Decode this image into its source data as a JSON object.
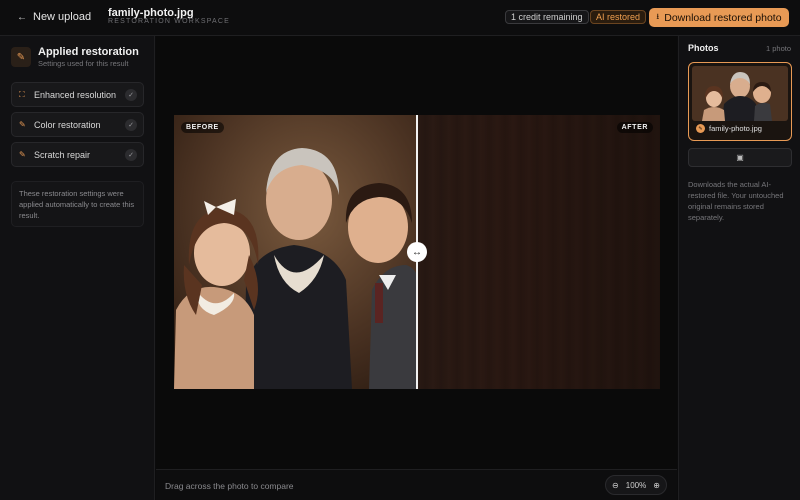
{
  "header": {
    "back_label": "New upload",
    "filename": "family-photo.jpg",
    "workspace_label": "RESTORATION WORKSPACE",
    "credits": "1 credit remaining",
    "ai_badge": "AI restored",
    "download_label": "Download restored photo"
  },
  "left_panel": {
    "title": "Applied restoration",
    "subtitle": "Settings used for this result",
    "items": [
      {
        "label": "Enhanced resolution",
        "icon": "resolution-icon"
      },
      {
        "label": "Color restoration",
        "icon": "color-wand-icon"
      },
      {
        "label": "Scratch repair",
        "icon": "repair-wand-icon"
      }
    ],
    "note": "These restoration settings were applied automatically to create this result."
  },
  "viewer": {
    "before_label": "BEFORE",
    "after_label": "AFTER",
    "split_position": 0.5,
    "hint": "Drag across the photo to compare",
    "zoom": "100%"
  },
  "right_panel": {
    "title": "Photos",
    "count": "1 photo",
    "thumb_name": "family-photo.jpg",
    "note": "Downloads the actual AI-restored file. Your untouched original remains stored separately."
  },
  "colors": {
    "accent": "#e89a55",
    "background": "#0b0b0c",
    "panel": "#111113"
  }
}
